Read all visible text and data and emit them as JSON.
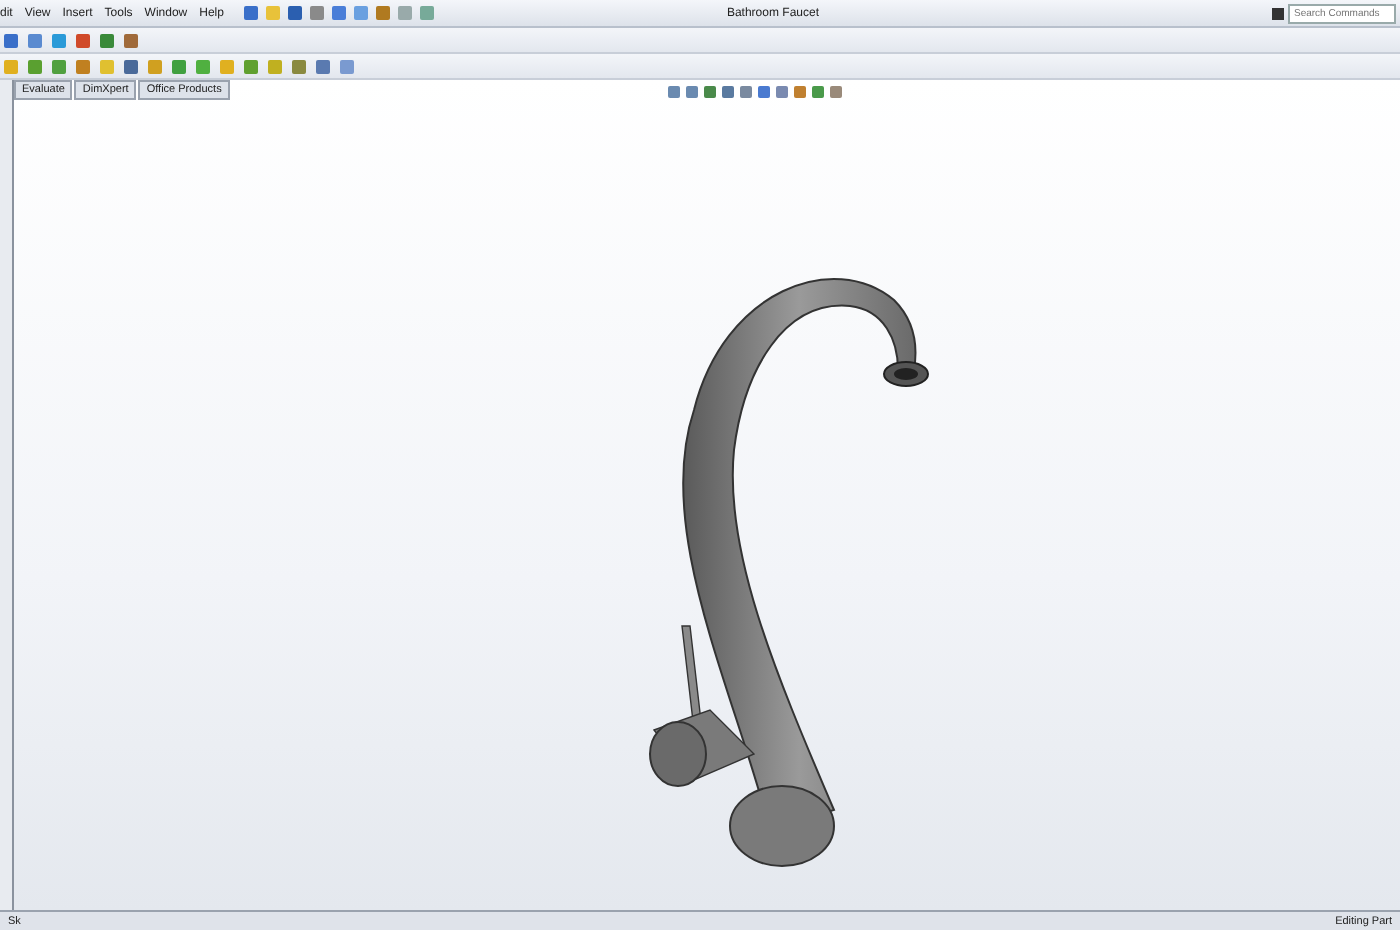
{
  "window": {
    "title": "Bathroom Faucet"
  },
  "menu": [
    "dit",
    "View",
    "Insert",
    "Tools",
    "Window",
    "Help"
  ],
  "search": {
    "placeholder": "Search Commands"
  },
  "tabs": [
    {
      "label": "Evaluate"
    },
    {
      "label": "DimXpert"
    },
    {
      "label": "Office Products"
    }
  ],
  "status_bar": {
    "left": "Sk",
    "right": "Editing Part"
  }
}
